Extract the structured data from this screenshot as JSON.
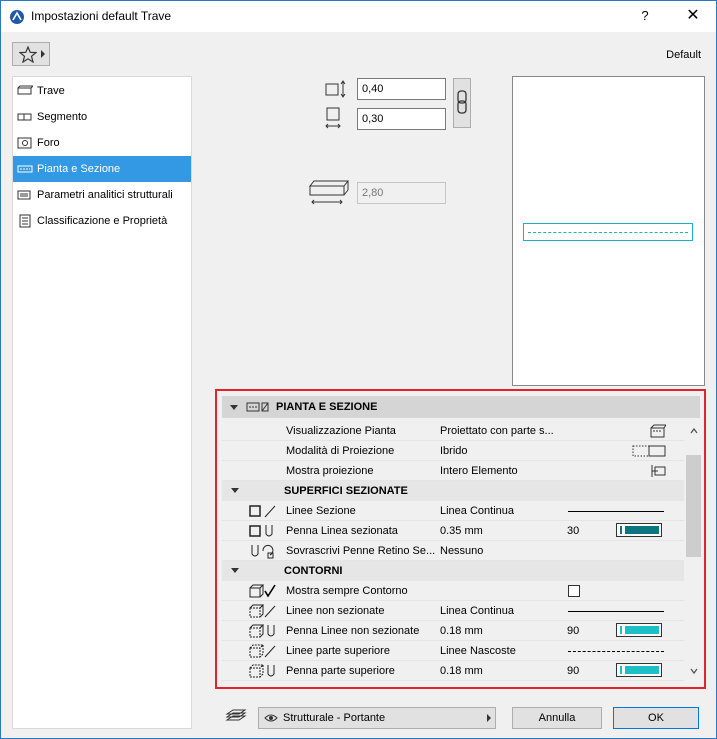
{
  "window": {
    "title": "Impostazioni default Trave",
    "help": "?",
    "close": "✕",
    "default_label": "Default"
  },
  "sidebar": {
    "items": [
      {
        "label": "Trave",
        "icon": "beam-icon"
      },
      {
        "label": "Segmento",
        "icon": "segment-icon"
      },
      {
        "label": "Foro",
        "icon": "hole-icon"
      },
      {
        "label": "Pianta e Sezione",
        "icon": "plan-section-icon",
        "selected": true
      },
      {
        "label": "Parametri analitici strutturali",
        "icon": "structural-analytics-icon"
      },
      {
        "label": "Classificazione e Proprietà",
        "icon": "classification-icon"
      }
    ]
  },
  "dimensions": {
    "width": "0,40",
    "height": "0,30",
    "length": "2,80"
  },
  "panel": {
    "title": "PIANTA E SEZIONE",
    "rows": [
      {
        "type": "row",
        "icon": "",
        "label": "Visualizzazione Pianta",
        "value": "Proiettato con parte s...",
        "right_icon": "plan-display-icon"
      },
      {
        "type": "row",
        "icon": "",
        "label": "Modalità di Proiezione",
        "value": "Ibrido",
        "right_icon": "projection-mode-icon"
      },
      {
        "type": "row",
        "icon": "",
        "label": "Mostra proiezione",
        "value": "Intero Elemento",
        "right_icon": "show-projection-icon"
      },
      {
        "type": "sub",
        "label": "SUPERFICI SEZIONATE"
      },
      {
        "type": "row",
        "icon": "cut-lines-icon",
        "label": "Linee Sezione",
        "value": "Linea Continua",
        "right": "solid"
      },
      {
        "type": "row",
        "icon": "cut-pen-icon",
        "label": "Penna Linea sezionata",
        "value": "0.35 mm",
        "num": "30",
        "right": "pen",
        "pen_color": "#0b7580"
      },
      {
        "type": "row",
        "icon": "override-pen-icon",
        "label": "Sovrascrivi Penne Retino Se...",
        "value": "Nessuno"
      },
      {
        "type": "sub",
        "label": "CONTORNI"
      },
      {
        "type": "row",
        "icon": "show-outline-icon",
        "label": "Mostra sempre Contorno",
        "value": "",
        "right": "checkbox"
      },
      {
        "type": "row",
        "icon": "uncut-lines-icon",
        "label": "Linee non sezionate",
        "value": "Linea Continua",
        "right": "solid"
      },
      {
        "type": "row",
        "icon": "uncut-pen-icon",
        "label": "Penna Linee non sezionate",
        "value": "0.18 mm",
        "num": "90",
        "right": "pen",
        "pen_color": "#1cbfc6"
      },
      {
        "type": "row",
        "icon": "overhead-lines-icon",
        "label": "Linee parte superiore",
        "value": "Linee Nascoste",
        "right": "dashed"
      },
      {
        "type": "row",
        "icon": "overhead-pen-icon",
        "label": "Penna parte superiore",
        "value": "0.18 mm",
        "num": "90",
        "right": "pen",
        "pen_color": "#1cbfc6"
      }
    ]
  },
  "bottom": {
    "layer": "Strutturale - Portante",
    "cancel": "Annulla",
    "ok": "OK"
  },
  "colors": {
    "selection": "#3399e5",
    "highlight_border": "#e0242c",
    "preview_line": "#1ab1c8"
  }
}
